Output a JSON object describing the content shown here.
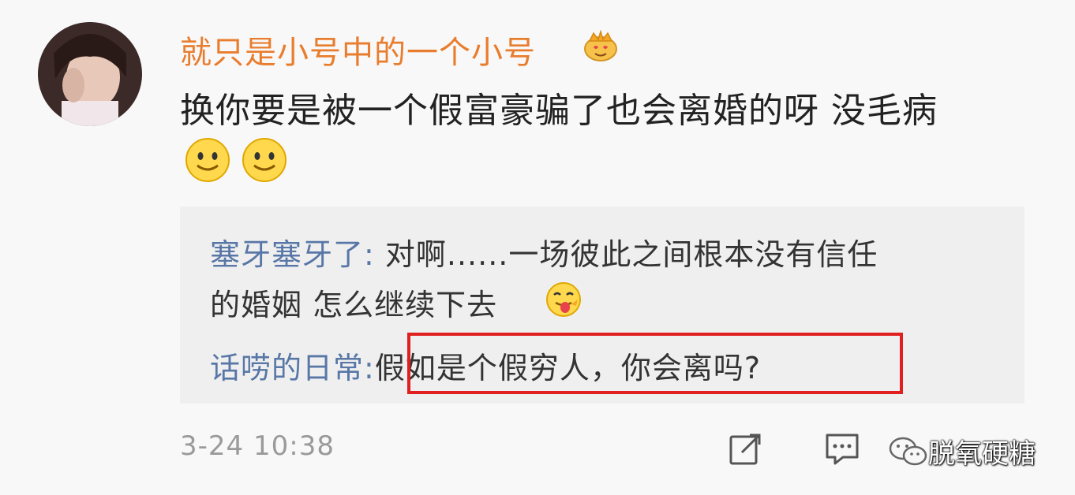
{
  "comment": {
    "username": "就只是小号中的一个小号",
    "text": "换你要是被一个假富豪骗了也会离婚的呀 没毛病",
    "emoji": [
      "smiley-icon",
      "smiley-icon"
    ],
    "timestamp": "3-24 10:38"
  },
  "replies": [
    {
      "name": "塞牙塞牙了:",
      "text_line1": " 对啊......一场彼此之间根本没有信任",
      "text_line2": "的婚姻 怎么继续下去"
    },
    {
      "name": "话唠的日常:",
      "text": "假如是个假穷人，你会离吗?"
    }
  ],
  "watermark": {
    "text": "脱氧硬糖"
  },
  "colors": {
    "username": "#e97d2e",
    "reply_name": "#5877a7",
    "highlight": "#e02020"
  }
}
